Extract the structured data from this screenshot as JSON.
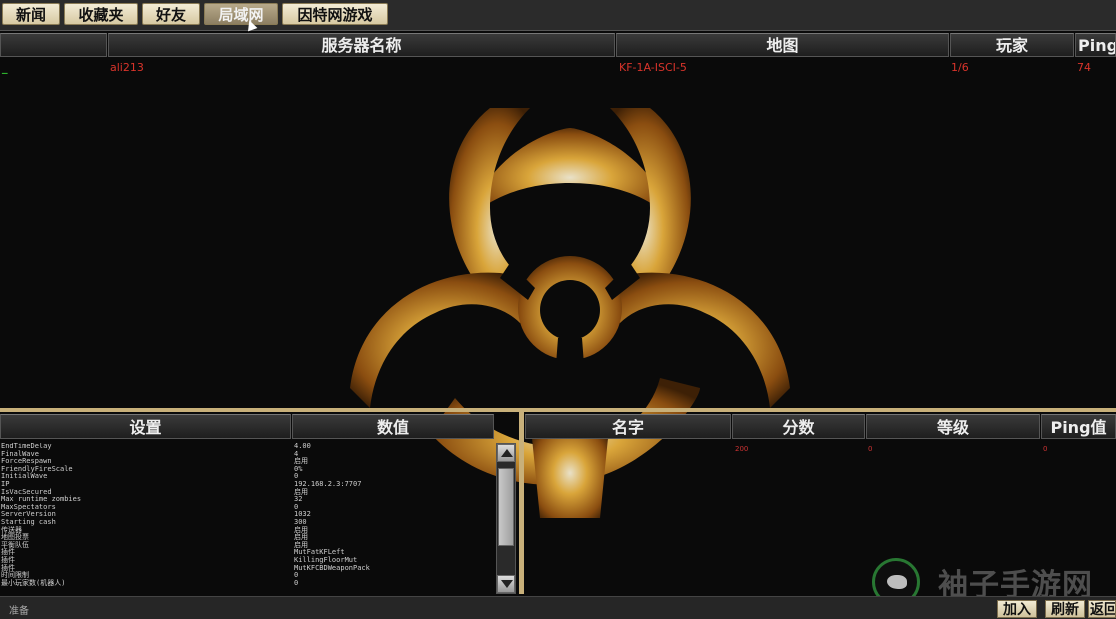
{
  "tabs": [
    {
      "label": "新闻"
    },
    {
      "label": "收藏夹"
    },
    {
      "label": "好友"
    },
    {
      "label": "局域网",
      "active": true
    },
    {
      "label": "因特网游戏"
    }
  ],
  "server_list": {
    "columns": [
      "",
      "服务器名称",
      "地图",
      "玩家",
      "Ping"
    ],
    "rows": [
      {
        "flag": "_",
        "name": "ali213",
        "map": "KF-1A-ISCI-5",
        "players": "1/6",
        "ping": "74"
      }
    ]
  },
  "settings_panel": {
    "columns": [
      "设置",
      "数值"
    ],
    "rows": [
      {
        "key": "EndTimeDelay",
        "value": "4.00"
      },
      {
        "key": "FinalWave",
        "value": "4"
      },
      {
        "key": "ForceRespawn",
        "value": "启用"
      },
      {
        "key": "FriendlyFireScale",
        "value": "0%"
      },
      {
        "key": "InitialWave",
        "value": "0"
      },
      {
        "key": "IP",
        "value": "192.168.2.3:7707"
      },
      {
        "key": "IsVacSecured",
        "value": "启用"
      },
      {
        "key": "Max runtime zombies",
        "value": "32"
      },
      {
        "key": "MaxSpectators",
        "value": "0"
      },
      {
        "key": "ServerVersion",
        "value": "1032"
      },
      {
        "key": "Starting cash",
        "value": "300"
      },
      {
        "key": "传送器",
        "value": "启用"
      },
      {
        "key": "地图投票",
        "value": "启用"
      },
      {
        "key": "平衡队伍",
        "value": "启用"
      },
      {
        "key": "插件",
        "value": "MutFatKFLeft"
      },
      {
        "key": "插件",
        "value": "KillingFloorMut"
      },
      {
        "key": "插件",
        "value": "MutKFCBDWeaponPack"
      },
      {
        "key": "时间限制",
        "value": "0"
      },
      {
        "key": "最小玩家数(机器人)",
        "value": "0"
      }
    ]
  },
  "players_panel": {
    "columns": [
      "名字",
      "分数",
      "等级",
      "Ping值"
    ],
    "rows": [
      {
        "name": "",
        "score": "200",
        "level": "0",
        "ping": "0"
      }
    ]
  },
  "status": {
    "text": "准备"
  },
  "buttons": {
    "join": "加入",
    "refresh": "刷新",
    "back": "返回"
  },
  "watermark": {
    "text": "袖子手游网"
  },
  "colors": {
    "accent": "#c8b07a",
    "row_text": "#d9342b",
    "tab_active": "#8d7f62"
  }
}
